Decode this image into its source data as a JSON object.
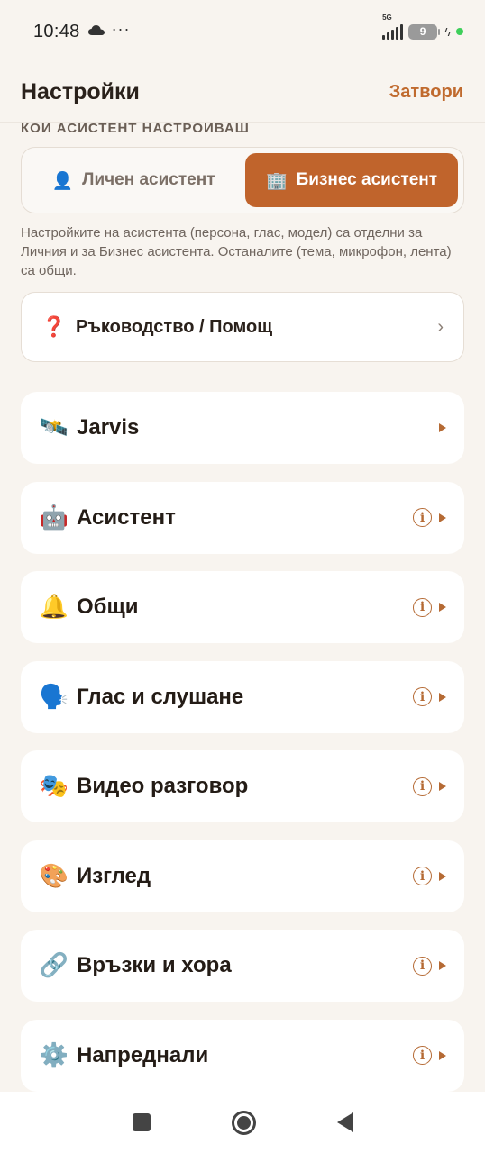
{
  "status_bar": {
    "time": "10:48",
    "more": "···",
    "network": "5G",
    "battery": "9",
    "icons": [
      "cloud-icon",
      "signal-icon",
      "battery-icon",
      "charging-icon",
      "green-dot-icon"
    ]
  },
  "header": {
    "title": "Настройки",
    "close_label": "Затвори"
  },
  "assistant_switch": {
    "section_label": "КОИ АСИСТЕНТ НАСТРОИВАШ",
    "options": [
      {
        "icon": "👤",
        "label": "Личен асистент",
        "active": false
      },
      {
        "icon": "🏢",
        "label": "Бизнес асистент",
        "active": true
      }
    ],
    "hint": "Настройките на асистента (персона, глас, модел) са отделни за Личния и за Бизнес асистента. Останалите (тема, микрофон, лента) са общи."
  },
  "help": {
    "icon": "❓",
    "label": "Ръководство / Помощ",
    "chevron": "›"
  },
  "sections": [
    {
      "icon": "🛰️",
      "label": "Jarvis",
      "info": false
    },
    {
      "icon": "🤖",
      "label": "Асистент",
      "info": true
    },
    {
      "icon": "🔔",
      "label": "Общи",
      "info": true
    },
    {
      "icon": "🗣️",
      "label": "Глас и слушане",
      "info": true
    },
    {
      "icon": "🎭",
      "label": "Видео разговор",
      "info": true
    },
    {
      "icon": "🎨",
      "label": "Изглед",
      "info": true
    },
    {
      "icon": "🔗",
      "label": "Връзки и хора",
      "info": true
    },
    {
      "icon": "⚙️",
      "label": "Напреднали",
      "info": true
    }
  ],
  "info_glyph": "i",
  "colors": {
    "accent": "#c0642c",
    "background": "#f8f4ef",
    "card": "#ffffff",
    "text": "#2a211b"
  }
}
